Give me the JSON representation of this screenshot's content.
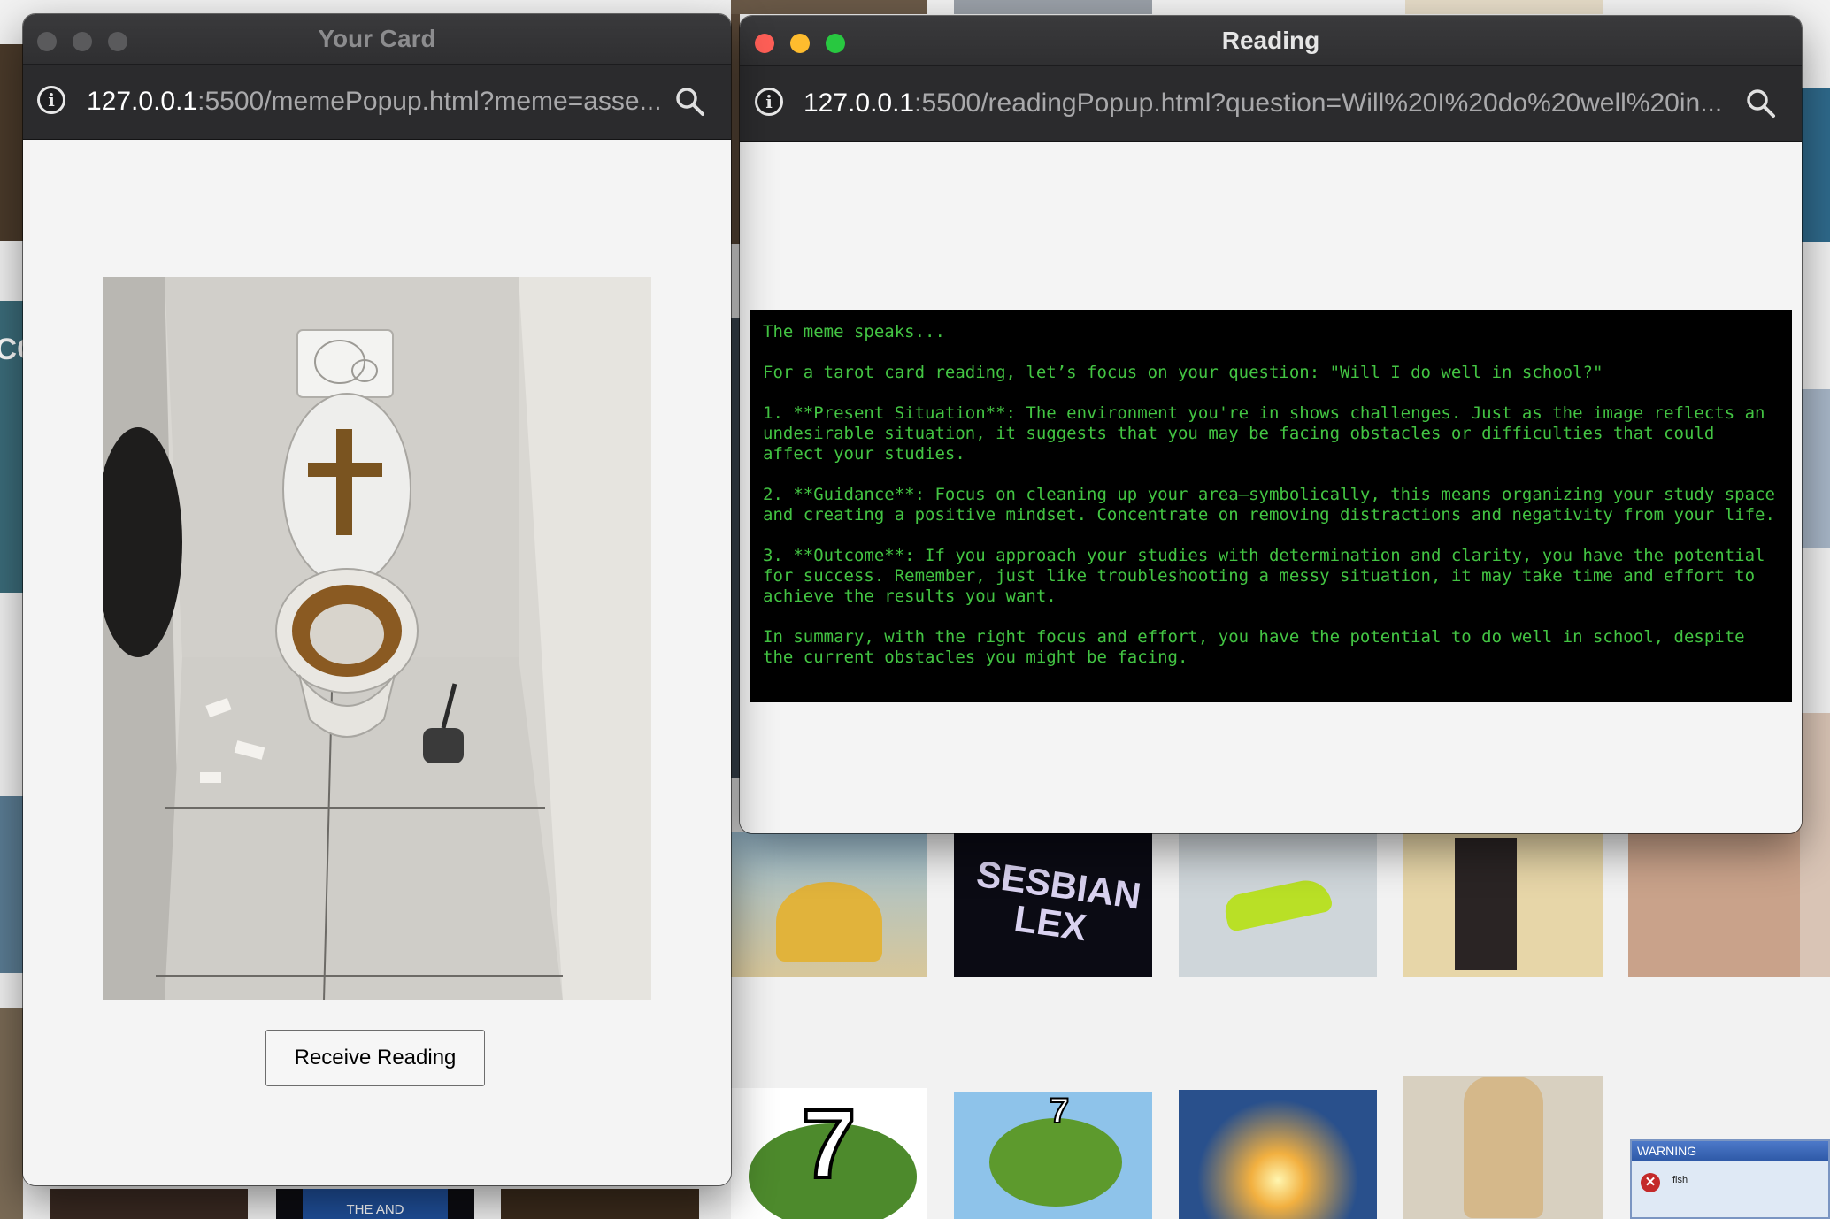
{
  "background": {
    "tiles": [
      {
        "label": ""
      },
      {
        "label": "SESBIAN LEX"
      },
      {
        "label": "7"
      },
      {
        "label": "7"
      },
      {
        "label": "THE AND"
      },
      {
        "label": "WARNING"
      },
      {
        "label": "fish"
      },
      {
        "label": "CO"
      }
    ]
  },
  "card_window": {
    "title": "Your Card",
    "url_host": "127.0.0.1",
    "url_rest": ":5500/memePopup.html?meme=asse...",
    "image_alt": "meme card image",
    "button_label": "Receive Reading"
  },
  "reading_window": {
    "title": "Reading",
    "url_host": "127.0.0.1",
    "url_rest": ":5500/readingPopup.html?question=Will%20I%20do%20well%20in...",
    "reading_text": "The meme speaks...\n\nFor a tarot card reading, let’s focus on your question: \"Will I do well in school?\"\n\n1. **Present Situation**: The environment you're in shows challenges. Just as the image reflects an undesirable situation, it suggests that you may be facing obstacles or difficulties that could affect your studies.\n\n2. **Guidance**: Focus on cleaning up your area—symbolically, this means organizing your study space and creating a positive mindset. Concentrate on removing distractions and negativity from your life.\n\n3. **Outcome**: If you approach your studies with determination and clarity, you have the potential for success. Remember, just like troubleshooting a messy situation, it may take time and effort to achieve the results you want.\n\nIn summary, with the right focus and effort, you have the potential to do well in school, despite the current obstacles you might be facing."
  },
  "colors": {
    "reading_text": "#43c443",
    "reading_bg": "#000000",
    "close": "#ff5f57",
    "minimize": "#febc2e",
    "zoom": "#28c840",
    "inactive_light": "#5a5a5c"
  },
  "icons": [
    "info-icon",
    "magnifier-icon"
  ]
}
